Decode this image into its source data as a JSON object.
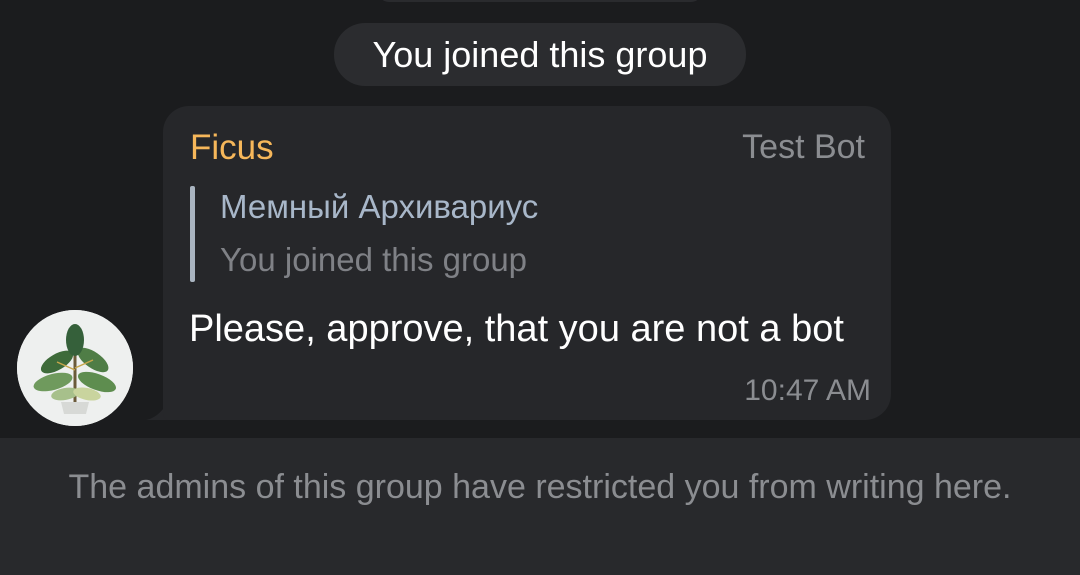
{
  "service": {
    "joined_label": "You joined this group"
  },
  "message": {
    "sender": "Ficus",
    "bot_tag": "Test Bot",
    "reply": {
      "name": "Мемный Архивариус",
      "text": "You joined this group"
    },
    "text": "Please, approve, that you are not a bot",
    "time": "10:47 AM"
  },
  "footer": {
    "restriction_text": "The admins of this group have restricted you from writing here."
  },
  "colors": {
    "sender_name": "#f6b75a",
    "reply_name": "#a8b7c9",
    "bubble": "#26272a",
    "background": "#1b1c1e"
  },
  "icons": {
    "avatar": "ficus-plant-avatar"
  }
}
